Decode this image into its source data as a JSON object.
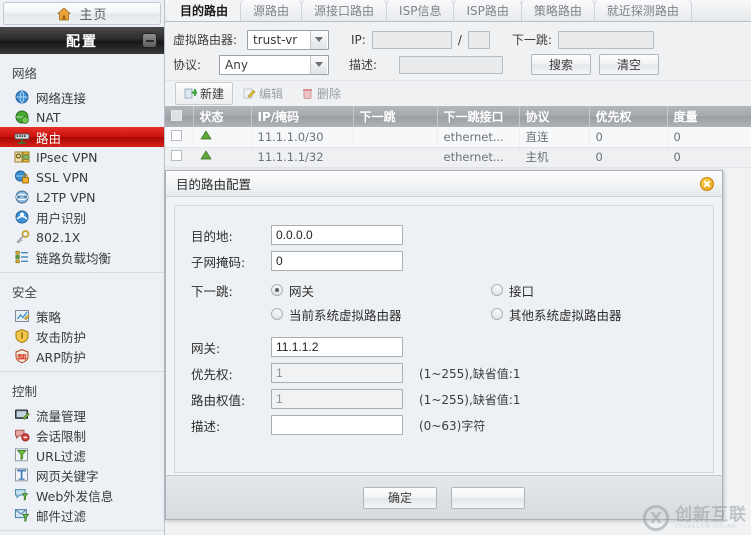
{
  "sidebar": {
    "home_label": "主页",
    "home_icon": "home-icon",
    "config_label": "配置",
    "collapse_icon": "minimize-icon",
    "groups": [
      {
        "title": "网络",
        "items": [
          {
            "label": "网络连接",
            "icon": "globe-blue-icon",
            "active": false
          },
          {
            "label": "NAT",
            "icon": "globe-green-icon",
            "active": false
          },
          {
            "label": "路由",
            "icon": "router-icon",
            "active": true
          },
          {
            "label": "IPsec VPN",
            "icon": "lock-list-icon",
            "active": false
          },
          {
            "label": "SSL VPN",
            "icon": "globe-lock-icon",
            "active": false
          },
          {
            "label": "L2TP VPN",
            "icon": "tunnel-icon",
            "active": false
          },
          {
            "label": "用户识别",
            "icon": "user-globe-icon",
            "active": false
          },
          {
            "label": "802.1X",
            "icon": "key-icon",
            "active": false
          },
          {
            "label": "链路负载均衡",
            "icon": "balance-icon",
            "active": false
          }
        ]
      },
      {
        "title": "安全",
        "items": [
          {
            "label": "策略",
            "icon": "policy-icon",
            "active": false
          },
          {
            "label": "攻击防护",
            "icon": "shield-icon",
            "active": false
          },
          {
            "label": "ARP防护",
            "icon": "arp-shield-icon",
            "active": false
          }
        ]
      },
      {
        "title": "控制",
        "items": [
          {
            "label": "流量管理",
            "icon": "traffic-icon",
            "active": false
          },
          {
            "label": "会话限制",
            "icon": "session-icon",
            "active": false
          },
          {
            "label": "URL过滤",
            "icon": "url-filter-icon",
            "active": false
          },
          {
            "label": "网页关键字",
            "icon": "keyword-icon",
            "active": false
          },
          {
            "label": "Web外发信息",
            "icon": "web-outgoing-icon",
            "active": false
          },
          {
            "label": "邮件过滤",
            "icon": "mail-filter-icon",
            "active": false
          }
        ]
      }
    ]
  },
  "tabs": [
    {
      "label": "目的路由",
      "active": true
    },
    {
      "label": "源路由",
      "active": false
    },
    {
      "label": "源接口路由",
      "active": false
    },
    {
      "label": "ISP信息",
      "active": false
    },
    {
      "label": "ISP路由",
      "active": false
    },
    {
      "label": "策略路由",
      "active": false
    },
    {
      "label": "就近探测路由",
      "active": false
    }
  ],
  "filter": {
    "vrouter_label": "虚拟路由器:",
    "vrouter_value": "trust-vr",
    "ip_label": "IP:",
    "ip_value": "",
    "slash": "/",
    "mask_value": "",
    "nexthop_label": "下一跳:",
    "nexthop_value": "",
    "protocol_label": "协议:",
    "protocol_value": "Any",
    "desc_label": "描述:",
    "desc_value": "",
    "search_button": "搜索",
    "clear_button": "清空"
  },
  "toolbar": {
    "new_label": "新建",
    "new_icon": "add-icon",
    "edit_label": "编辑",
    "edit_icon": "edit-icon",
    "delete_label": "删除",
    "delete_icon": "trash-icon"
  },
  "table": {
    "columns": [
      "",
      "状态",
      "IP/掩码",
      "下一跳",
      "下一跳接口",
      "协议",
      "优先权",
      "度量"
    ],
    "rows": [
      {
        "status_icon": "connected-icon",
        "ip_mask": "11.1.1.0/30",
        "next_hop": "",
        "next_hop_if": "ethernet...",
        "protocol": "直连",
        "priority": "0",
        "metric": "0"
      },
      {
        "status_icon": "connected-icon",
        "ip_mask": "11.1.1.1/32",
        "next_hop": "",
        "next_hop_if": "ethernet...",
        "protocol": "主机",
        "priority": "0",
        "metric": "0"
      }
    ]
  },
  "dialog": {
    "title": "目的路由配置",
    "close_icon": "close-icon",
    "dest_label": "目的地:",
    "dest_value": "0.0.0.0",
    "mask_label": "子网掩码:",
    "mask_value": "0",
    "nexthop_label": "下一跳:",
    "radio_gateway": "网关",
    "radio_interface": "接口",
    "radio_current_vr": "当前系统虚拟路由器",
    "radio_other_vr": "其他系统虚拟路由器",
    "gateway_label": "网关:",
    "gateway_value": "11.1.1.2",
    "priority_label": "优先权:",
    "priority_value": "1",
    "priority_hint": "(1~255),缺省值:1",
    "weight_label": "路由权值:",
    "weight_value": "1",
    "weight_hint": "(1~255),缺省值:1",
    "desc_label": "描述:",
    "desc_value": "",
    "desc_hint": "(0~63)字符",
    "ok_button": "确定",
    "cancel_button": ""
  },
  "watermark": {
    "mark": "X",
    "name": "创新互联",
    "sub": "CHUANGXIN HULIAN"
  },
  "colors": {
    "accent_red": "#c8110d",
    "header_dark": "#2b2b2b",
    "table_header": "#a4a8ad"
  }
}
